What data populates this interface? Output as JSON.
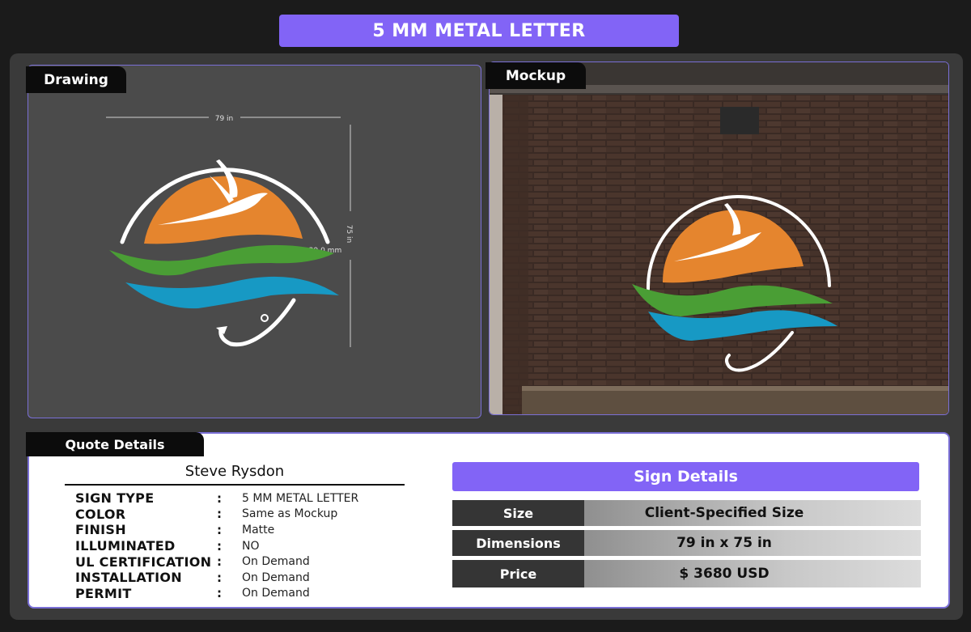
{
  "header": {
    "title": "5 MM METAL LETTER"
  },
  "tabs": {
    "drawing": "Drawing",
    "mockup": "Mockup",
    "quote": "Quote Details"
  },
  "drawing": {
    "width_label": "79 in",
    "height_label": "75 in",
    "thickness_label": "29.0 mm"
  },
  "quote": {
    "client_name": "Steve Rysdon",
    "specs": [
      {
        "label": "SIGN TYPE",
        "value": "5 MM METAL LETTER"
      },
      {
        "label": "COLOR",
        "value": "Same as Mockup"
      },
      {
        "label": "FINISH",
        "value": "Matte"
      },
      {
        "label": "ILLUMINATED",
        "value": "NO"
      },
      {
        "label": "UL CERTIFICATION",
        "value": "On Demand"
      },
      {
        "label": "INSTALLATION",
        "value": "On Demand"
      },
      {
        "label": "PERMIT",
        "value": "On Demand"
      }
    ],
    "colon": ":"
  },
  "sign_details": {
    "title": "Sign Details",
    "rows": [
      {
        "key": "Size",
        "value": "Client-Specified Size"
      },
      {
        "key": "Dimensions",
        "value": "79 in x 75 in"
      },
      {
        "key": "Price",
        "value": "$ 3680 USD"
      }
    ]
  },
  "colors": {
    "accent": "#8264f6",
    "sun": "#e5852e",
    "green": "#4a9e35",
    "blue": "#1799c4",
    "panel_border": "#7a6fd6"
  }
}
